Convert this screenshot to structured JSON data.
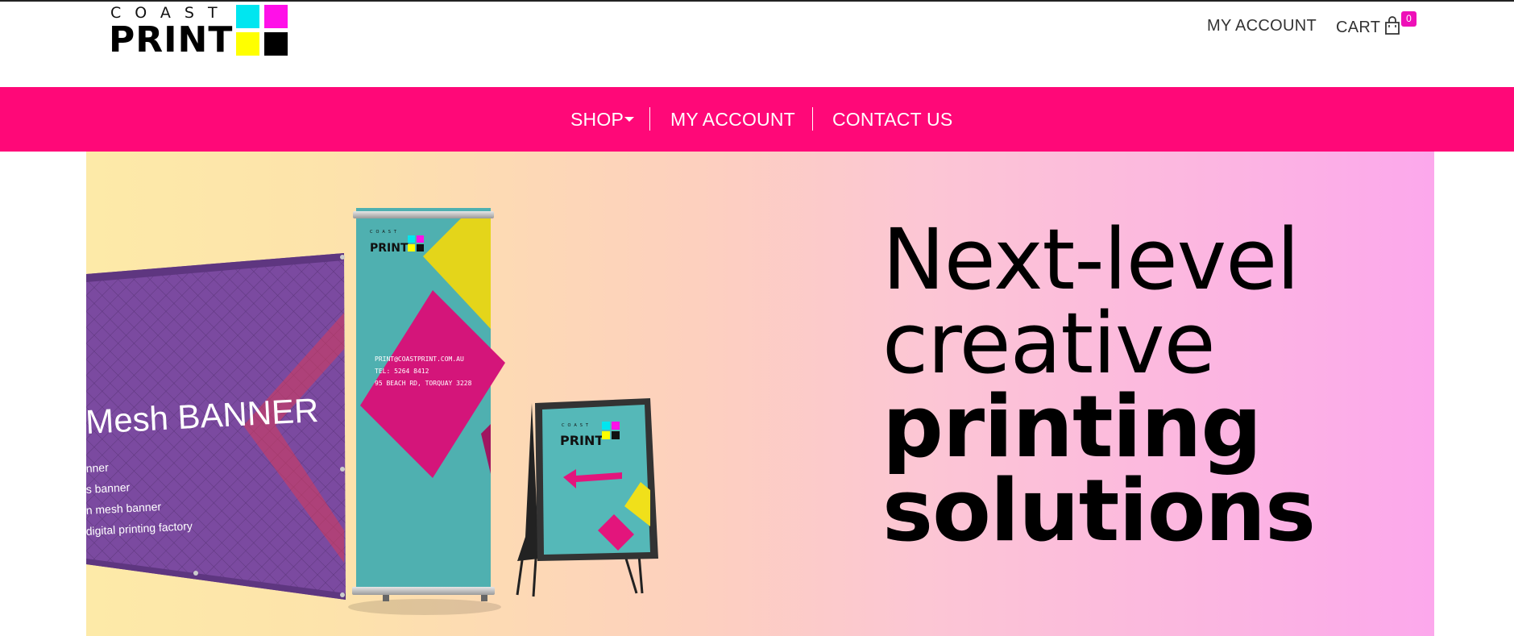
{
  "header": {
    "logo": {
      "top_text": "COAST",
      "main_text": "PRINT"
    },
    "my_account_label": "MY ACCOUNT",
    "cart_label": "CART",
    "cart_count": "0"
  },
  "nav": {
    "shop_label": "SHOP",
    "my_account_label": "MY ACCOUNT",
    "contact_label": "CONTACT US"
  },
  "hero": {
    "headline_line1": "Next-level",
    "headline_line2": "creative",
    "headline_line3": "printing",
    "headline_line4": "solutions",
    "banner": {
      "title": "Mesh BANNER",
      "lines": [
        "nner",
        "s banner",
        "n mesh banner",
        "digital printing factory"
      ]
    },
    "pullup": {
      "logo_top": "COAST",
      "logo_main": "PRINT",
      "email": "PRINT@COASTPRINT.COM.AU",
      "tel": "TEL: 5264 8412",
      "address": "95 BEACH RD, TORQUAY 3228"
    },
    "sign": {
      "logo_top": "COAST",
      "logo_main": "PRINT"
    }
  },
  "colors": {
    "nav_bg": "#ff0878",
    "cyan": "#00e6f0",
    "magenta": "#ff10e8",
    "yellow": "#ffff00",
    "badge": "#ee10b8"
  }
}
